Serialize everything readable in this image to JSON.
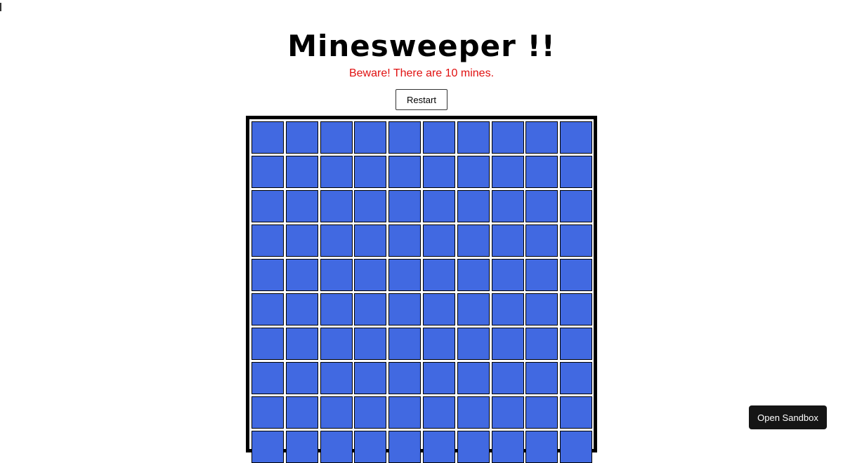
{
  "game": {
    "title": "Minesweeper !!",
    "warning": "Beware! There are 10 mines.",
    "restart_label": "Restart",
    "columns": 10,
    "visible_rows": 10,
    "mine_count": 10
  },
  "sandbox": {
    "open_label": "Open Sandbox"
  },
  "colors": {
    "cell_hidden": "#4169e1",
    "warning_text": "#e01010",
    "board_border": "#000000"
  },
  "icons": {
    "corner_mark": "text-cursor-icon"
  }
}
